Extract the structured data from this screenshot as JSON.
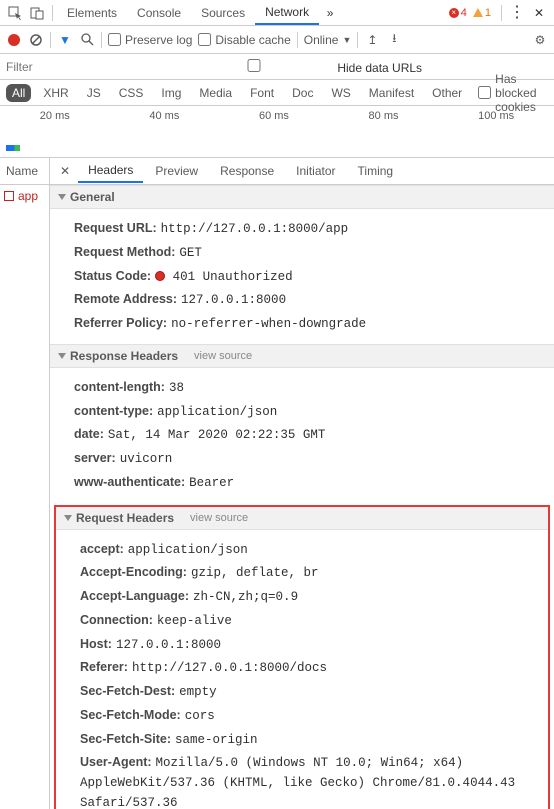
{
  "topTabs": {
    "elements": "Elements",
    "console": "Console",
    "sources": "Sources",
    "network": "Network"
  },
  "badges": {
    "errors": "4",
    "warnings": "1"
  },
  "toolbar": {
    "preserve": "Preserve log",
    "disable": "Disable cache",
    "online": "Online"
  },
  "filter": {
    "placeholder": "Filter",
    "hide": "Hide data URLs"
  },
  "types": {
    "all": "All",
    "xhr": "XHR",
    "js": "JS",
    "css": "CSS",
    "img": "Img",
    "media": "Media",
    "font": "Font",
    "doc": "Doc",
    "ws": "WS",
    "manifest": "Manifest",
    "other": "Other",
    "blocked": "Has blocked cookies"
  },
  "timeline": [
    "20 ms",
    "40 ms",
    "60 ms",
    "80 ms",
    "100 ms"
  ],
  "left": {
    "hdr": "Name",
    "item": "app"
  },
  "dtabs": {
    "headers": "Headers",
    "preview": "Preview",
    "response": "Response",
    "initiator": "Initiator",
    "timing": "Timing"
  },
  "sections": {
    "general": "General",
    "respH": "Response Headers",
    "reqH": "Request Headers",
    "viewSource": "view source"
  },
  "general": {
    "url_k": "Request URL:",
    "url_v": "http://127.0.0.1:8000/app",
    "method_k": "Request Method:",
    "method_v": "GET",
    "status_k": "Status Code:",
    "status_v": "401 Unauthorized",
    "remote_k": "Remote Address:",
    "remote_v": "127.0.0.1:8000",
    "ref_k": "Referrer Policy:",
    "ref_v": "no-referrer-when-downgrade"
  },
  "resp": {
    "cl_k": "content-length:",
    "cl_v": "38",
    "ct_k": "content-type:",
    "ct_v": "application/json",
    "date_k": "date:",
    "date_v": "Sat, 14 Mar 2020 02:22:35 GMT",
    "srv_k": "server:",
    "srv_v": "uvicorn",
    "wa_k": "www-authenticate:",
    "wa_v": "Bearer"
  },
  "req": {
    "ac_k": "accept:",
    "ac_v": "application/json",
    "ae_k": "Accept-Encoding:",
    "ae_v": "gzip, deflate, br",
    "al_k": "Accept-Language:",
    "al_v": "zh-CN,zh;q=0.9",
    "co_k": "Connection:",
    "co_v": "keep-alive",
    "ho_k": "Host:",
    "ho_v": "127.0.0.1:8000",
    "rf_k": "Referer:",
    "rf_v": "http://127.0.0.1:8000/docs",
    "sfd_k": "Sec-Fetch-Dest:",
    "sfd_v": "empty",
    "sfm_k": "Sec-Fetch-Mode:",
    "sfm_v": "cors",
    "sfs_k": "Sec-Fetch-Site:",
    "sfs_v": "same-origin",
    "ua_k": "User-Agent:",
    "ua_v": "Mozilla/5.0 (Windows NT 10.0; Win64; x64) AppleWebKit/537.36 (KHTML, like Gecko) Chrome/81.0.4044.43 Safari/537.36"
  }
}
